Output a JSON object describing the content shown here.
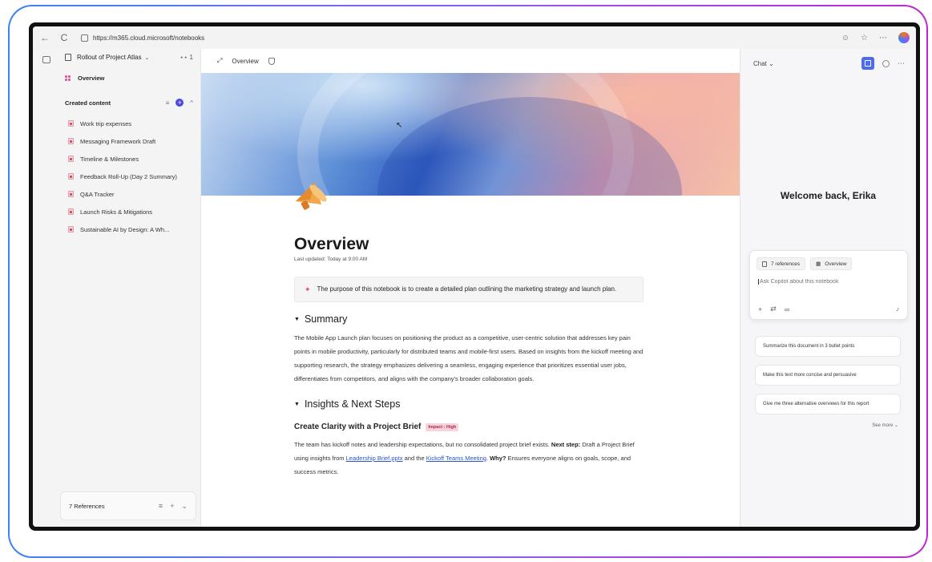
{
  "browser": {
    "url": "https://m365.cloud.microsoft/notebooks",
    "back_icon": "←",
    "refresh_icon": "C"
  },
  "sidebar": {
    "notebook_title": "Rollout of Project Atlas",
    "collaborators": "1",
    "overview_label": "Overview",
    "created_content_label": "Created content",
    "items": [
      {
        "label": "Work trip expenses"
      },
      {
        "label": "Messaging Framework Draft"
      },
      {
        "label": "Timeline & Milestones"
      },
      {
        "label": "Feedback Roll-Up (Day 2 Summary)"
      },
      {
        "label": "Q&A Tracker"
      },
      {
        "label": "Launch Risks & Mitigations"
      },
      {
        "label": "Sustainable AI by Design: A Wh..."
      }
    ],
    "references_label": "7 References"
  },
  "main": {
    "breadcrumb": "Overview",
    "title": "Overview",
    "last_updated": "Last updated: Today at 9:00 AM",
    "callout": "The purpose of this notebook is to create a detailed plan outlining the marketing strategy and launch plan.",
    "summary_heading": "Summary",
    "summary_text": "The Mobile App Launch plan focuses on positioning the product as a competitive, user-centric solution that addresses key pain points in mobile productivity, particularly for distributed teams and mobile-first users. Based on insights from the kickoff meeting and supporting research, the strategy emphasizes delivering a seamless, engaging experience that prioritizes essential user jobs, differentiates from competitors, and aligns with the company's broader collaboration goals.",
    "insights_heading": "Insights & Next Steps",
    "brief_heading": "Create Clarity with a Project Brief",
    "impact_badge": "Impact : High",
    "brief_text_1": "The team has kickoff notes and leadership expectations, but no consolidated project brief exists.",
    "brief_next_label": "Next step:",
    "brief_text_2": "Draft a Project Brief using insights from",
    "brief_link_1": "Leadership Brief.pptx",
    "brief_text_3": "and the",
    "brief_link_2": "Kickoff Teams Meeting",
    "brief_why_label": "Why?",
    "brief_text_4": "Ensures everyone aligns on goals, scope, and success metrics."
  },
  "chat": {
    "mode_label": "Chat",
    "welcome": "Welcome back, Erika",
    "chip_references": "7 references",
    "chip_overview": "Overview",
    "input_placeholder": "Ask Copilot about this notebook",
    "suggestions": [
      {
        "label": "Summarize this document in 3 bullet points"
      },
      {
        "label": "Make this text more concise and persuasive"
      },
      {
        "label": "Give me three alternative overviews for this report"
      }
    ],
    "see_more": "See more"
  },
  "colors": {
    "accent": "#4f46e5",
    "brand_pink": "#e0457b",
    "impact_bg": "#f7d3db"
  }
}
